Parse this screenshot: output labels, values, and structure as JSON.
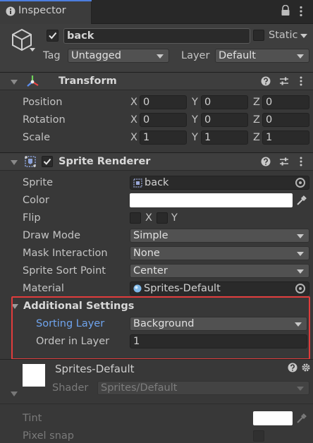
{
  "tab": {
    "title": "Inspector"
  },
  "object": {
    "name": "back",
    "static_label": "Static",
    "tag_label": "Tag",
    "tag_value": "Untagged",
    "layer_label": "Layer",
    "layer_value": "Default"
  },
  "transform": {
    "title": "Transform",
    "rows": [
      {
        "label": "Position",
        "x": "0",
        "y": "0",
        "z": "0"
      },
      {
        "label": "Rotation",
        "x": "0",
        "y": "0",
        "z": "0"
      },
      {
        "label": "Scale",
        "x": "1",
        "y": "1",
        "z": "1"
      }
    ],
    "axes": [
      "X",
      "Y",
      "Z"
    ]
  },
  "sprite_renderer": {
    "title": "Sprite Renderer",
    "sprite_label": "Sprite",
    "sprite_value": "back",
    "color_label": "Color",
    "color_value": "#ffffff",
    "flip_label": "Flip",
    "flip_x": "X",
    "flip_y": "Y",
    "draw_mode_label": "Draw Mode",
    "draw_mode_value": "Simple",
    "mask_label": "Mask Interaction",
    "mask_value": "None",
    "sort_point_label": "Sprite Sort Point",
    "sort_point_value": "Center",
    "material_label": "Material",
    "material_value": "Sprites-Default",
    "additional": {
      "title": "Additional Settings",
      "sorting_layer_label": "Sorting Layer",
      "sorting_layer_value": "Background",
      "order_label": "Order in Layer",
      "order_value": "1"
    }
  },
  "material": {
    "name": "Sprites-Default",
    "shader_label": "Shader",
    "shader_value": "Sprites/Default",
    "tint_label": "Tint",
    "pixel_snap_label": "Pixel snap"
  },
  "colors": {
    "highlight": "#e03c3c",
    "sorting_layer_text": "#6fa4ee",
    "tint": "#ffffff"
  }
}
